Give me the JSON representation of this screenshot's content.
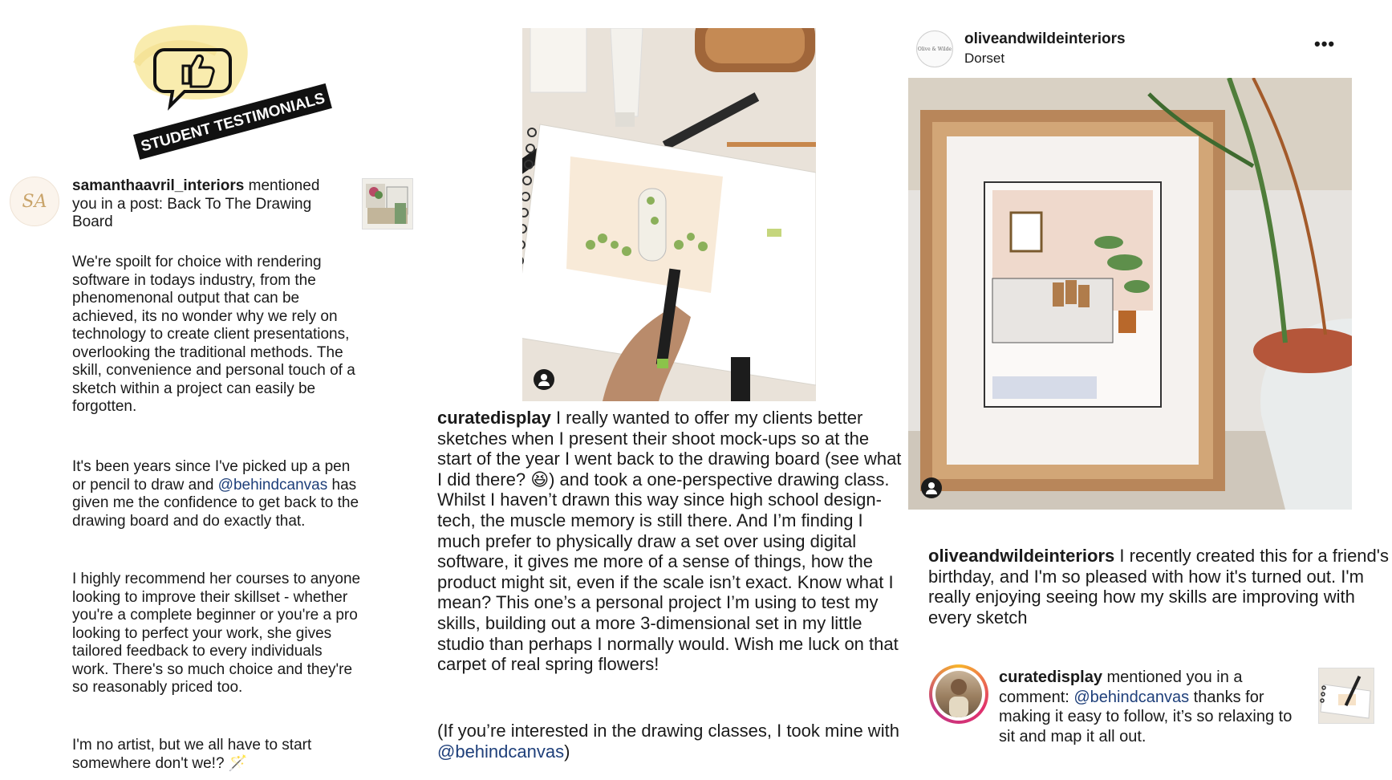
{
  "banner": {
    "label": "STUDENT TESTIMONIALS",
    "icon": "thumbs-up-speech-bubble-icon",
    "highlight_color": "#f9ecae"
  },
  "left_notification": {
    "avatar_initials": "SA",
    "username": "samanthaavril_interiors",
    "text": " mentioned you in a post: Back To The Drawing Board"
  },
  "left_paragraphs": {
    "p1": "We're spoilt for choice with rendering software in todays industry, from the phenomenonal output that can be achieved, its no wonder why we rely on technology to create client presentations, overlooking the traditional methods. The skill, convenience and personal touch of a sketch within a project can easily be forgotten.",
    "p2_before": "It's been years since I've picked up a pen or pencil to draw and ",
    "p2_mention": "@behindcanvas",
    "p2_after": " has given me the confidence to get back to the drawing board and do exactly that.",
    "p3": "I highly recommend her courses to anyone looking to improve their skillset - whether you're a complete beginner or you're a pro looking to perfect your work, she gives tailored feedback to every individuals work. There's so much choice and they're so reasonably priced too.",
    "p4": "I'm no artist, but we all have to start somewhere don't we!? 🪄"
  },
  "middle_post": {
    "username": "curatedisplay",
    "caption": " I really wanted to offer my clients better sketches when I present their shoot mock-ups so at the start of the year I went back to the drawing board (see what I did there? 😆) and took a one-perspective drawing class. Whilst I haven’t drawn this way since high school design-tech, the muscle memory is still there. And I’m finding I much prefer to physically draw a set over using digital software, it gives me more of a sense of things, how the product might sit, even if the scale isn’t exact. Know what I mean? This one’s a personal project I’m using to test my skills, building out a more 3-dimensional set in my little studio than perhaps I normally would. Wish me luck on that carpet of real spring flowers!",
    "footer_before": "(If you’re interested in the drawing classes, I took mine with ",
    "footer_mention": "@behindcanvas",
    "footer_after": ")"
  },
  "right_post": {
    "avatar_text": "Olive & Wilde",
    "username": "oliveandwildeinteriors",
    "location": "Dorset",
    "more_label": "•••",
    "caption_username": "oliveandwildeinteriors",
    "caption": " I recently created this for a friend's birthday, and I'm so pleased with how it's turned out. I'm really enjoying seeing how my skills are improving with every sketch"
  },
  "right_notification": {
    "username": "curatedisplay",
    "text_before": " mentioned you in a comment: ",
    "mention": "@behindcanvas",
    "text_after": " thanks for making it easy to follow, it’s so relaxing to sit and map it all out."
  },
  "colors": {
    "mention": "#1e3f7a",
    "banner_black": "#111111",
    "story_ring": "#e1306c"
  }
}
